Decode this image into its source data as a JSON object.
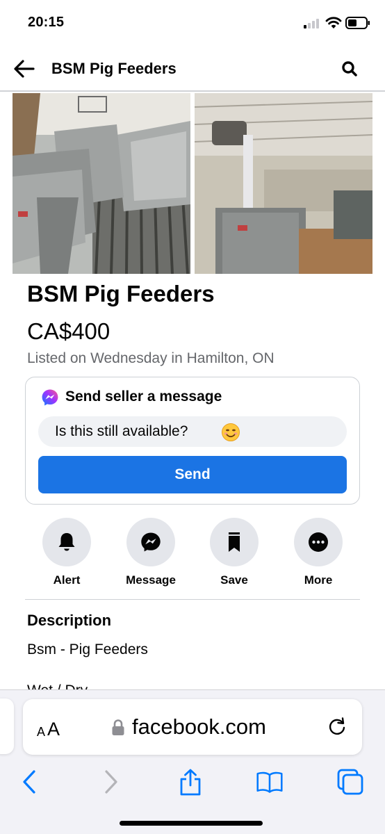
{
  "status_bar": {
    "time": "20:15"
  },
  "header": {
    "title": "BSM Pig Feeders"
  },
  "listing": {
    "title": "BSM Pig Feeders",
    "price": "CA$400",
    "listed": "Listed on Wednesday in Hamilton, ON"
  },
  "message_card": {
    "heading": "Send seller a message",
    "input_value": "Is this still available?",
    "send_label": "Send"
  },
  "actions": [
    {
      "label": "Alert",
      "icon": "bell-icon"
    },
    {
      "label": "Message",
      "icon": "messenger-icon"
    },
    {
      "label": "Save",
      "icon": "bookmark-icon"
    },
    {
      "label": "More",
      "icon": "more-icon"
    }
  ],
  "description": {
    "heading": "Description",
    "lines": [
      "Bsm - Pig Feeders",
      "Wet / Dry"
    ]
  },
  "browser": {
    "aa_small": "A",
    "aa_big": "A",
    "url": "facebook.com"
  },
  "colors": {
    "accent": "#1b74e4",
    "secondary_text": "#65676b",
    "action_circle": "#e4e6eb",
    "safari_blue": "#007aff"
  }
}
